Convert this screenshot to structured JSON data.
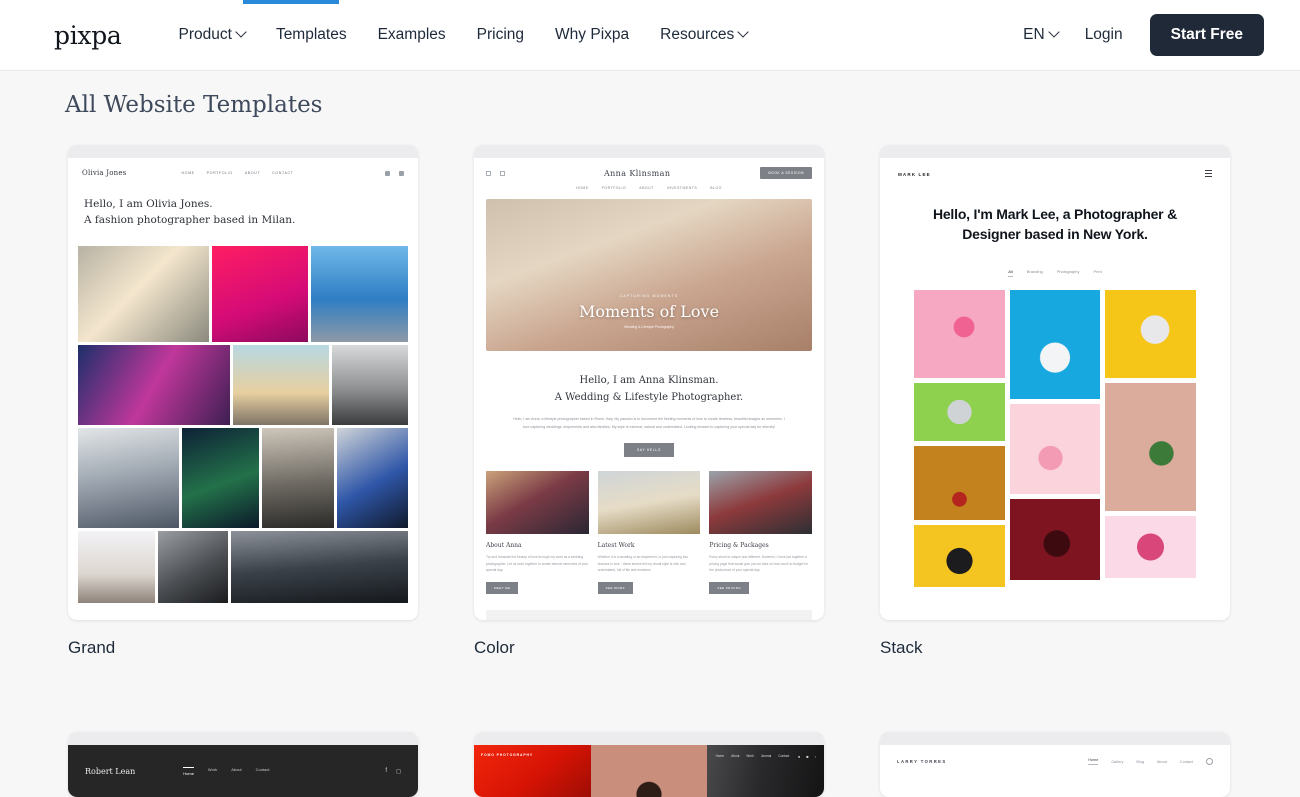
{
  "header": {
    "brand": "pixpa",
    "nav": [
      {
        "label": "Product",
        "caret": true
      },
      {
        "label": "Templates",
        "caret": false
      },
      {
        "label": "Examples",
        "caret": false
      },
      {
        "label": "Pricing",
        "caret": false
      },
      {
        "label": "Why Pixpa",
        "caret": false
      },
      {
        "label": "Resources",
        "caret": true
      }
    ],
    "language": "EN",
    "login_label": "Login",
    "cta_label": "Start Free",
    "cta_color": "#1f2937",
    "progress_color": "#2a8ada"
  },
  "page": {
    "title": "All Website Templates",
    "background": "#f7f7f7"
  },
  "templates": [
    {
      "name": "Grand"
    },
    {
      "name": "Color"
    },
    {
      "name": "Stack"
    }
  ],
  "grand_preview": {
    "logo": "Olivia Jones",
    "nav": [
      "HOME",
      "PORTFOLIO",
      "ABOUT",
      "CONTACT"
    ],
    "headline_line1": "Hello, I am Olivia Jones.",
    "headline_line2": "A fashion photographer based in Milan."
  },
  "color_preview": {
    "logo": "Anna Klinsman",
    "nav": [
      "HOME",
      "PORTFOLIO",
      "ABOUT",
      "INVESTMENTS",
      "BLOG"
    ],
    "book_button": "BOOK A SESSION",
    "hero_kicker": "CAPTURING MOMENTS",
    "hero_title": "Moments of Love",
    "hero_sub": "Wedding & Lifestyle Photography",
    "about_line1": "Hello, I am Anna Klinsman.",
    "about_line2": "A Wedding & Lifestyle Photographer.",
    "about_body": "Hello, I am Anna, a lifestyle photographer based in Rome, Italy. My passion is to document the fleeting moments of love to create timeless, beautiful images as memories. I love capturing weddings, elopements and also families. My style is minimal, natural and understated. Looking forward to capturing your special day for eternity!",
    "about_cta": "SAY HELLO",
    "columns": [
      {
        "title": "About Anna",
        "body": "Try and translate the beauty of love through my work as a wedding photographer. Let us work together to create eternal memories of your special day.",
        "button": "MEET ME"
      },
      {
        "title": "Latest Work",
        "body": "Whether it is a wedding or an elopement, or just capturing two humans in love - these stories tell my visual style is chic and understated, full of life and emotions.",
        "button": "SEE WORK"
      },
      {
        "title": "Pricing & Packages",
        "body": "Every shoot is unique and different. However, I have put together a pricing page that would give you an idea on how much to budget for the photoshoot of your special day.",
        "button": "SEE PRICING"
      }
    ]
  },
  "stack_preview": {
    "logo": "MARK LEE",
    "headline": "Hello, I'm Mark Lee, a Photographer & Designer based in New York.",
    "filters": [
      "All",
      "Branding",
      "Photography",
      "Print"
    ],
    "tile_colors": [
      "#f6a8c3",
      "#8ed14f",
      "#c4821f",
      "#f4c521",
      "#17a8e0",
      "#fbd3dc",
      "#7d1420",
      "#f5c518",
      "#dbab9c",
      "#fbd9e6"
    ]
  },
  "robert_preview": {
    "logo": "Robert Lean",
    "nav": [
      "Home",
      "Work",
      "About",
      "Contact"
    ],
    "bar_color": "#262626"
  },
  "fomo_preview": {
    "label": "FOMO PHOTOGRAPHY",
    "nav": [
      "Home",
      "About",
      "Work",
      "Journal",
      "Contact"
    ],
    "accent": "#e01c07"
  },
  "larry_preview": {
    "logo": "LARRY TORRES",
    "nav": [
      "Home",
      "Gallery",
      "Blog",
      "About",
      "Contact"
    ]
  }
}
